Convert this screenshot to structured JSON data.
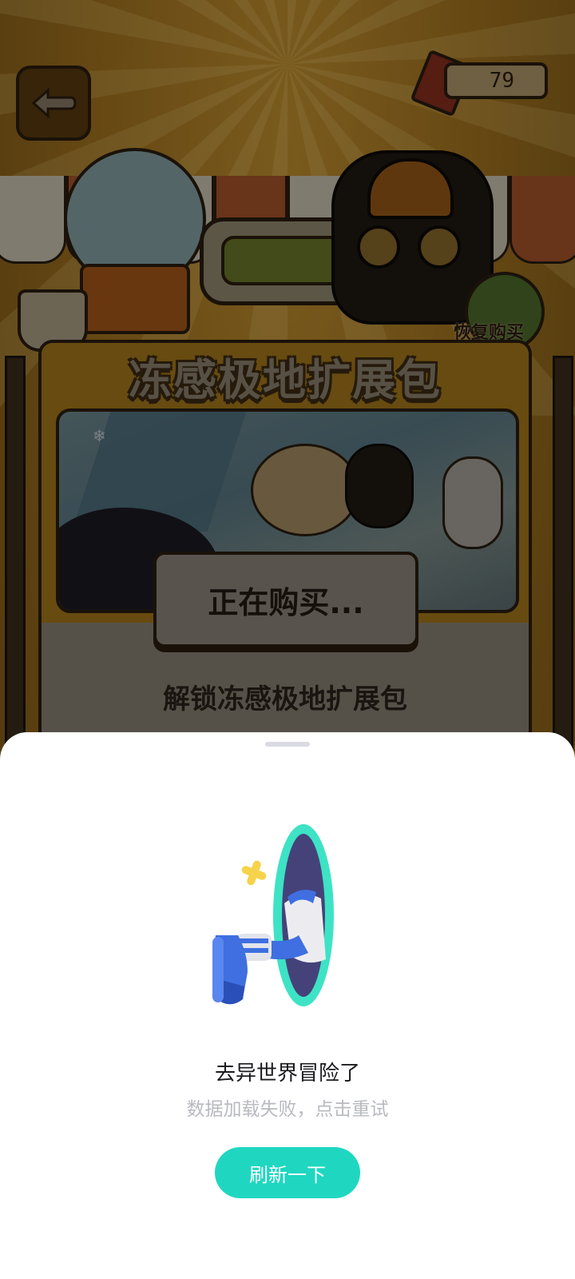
{
  "game": {
    "coin_count": "79",
    "restore_label": "恢复购买",
    "pack_title": "冻感极地扩展包",
    "unlock_label": "解锁冻感极地扩展包",
    "buying_status": "正在购买..."
  },
  "error_sheet": {
    "title": "去异世界冒险了",
    "message": "数据加载失败，点击重试",
    "refresh_label": "刷新一下"
  },
  "colors": {
    "accent": "#1fd7c0",
    "portal": "#3de3c4",
    "sparkle": "#f6d34a",
    "shoe": "#3f6fe0"
  },
  "icons": [
    "back-arrow-icon",
    "ticket-icon",
    "snowflake-icon",
    "portal-illustration"
  ]
}
